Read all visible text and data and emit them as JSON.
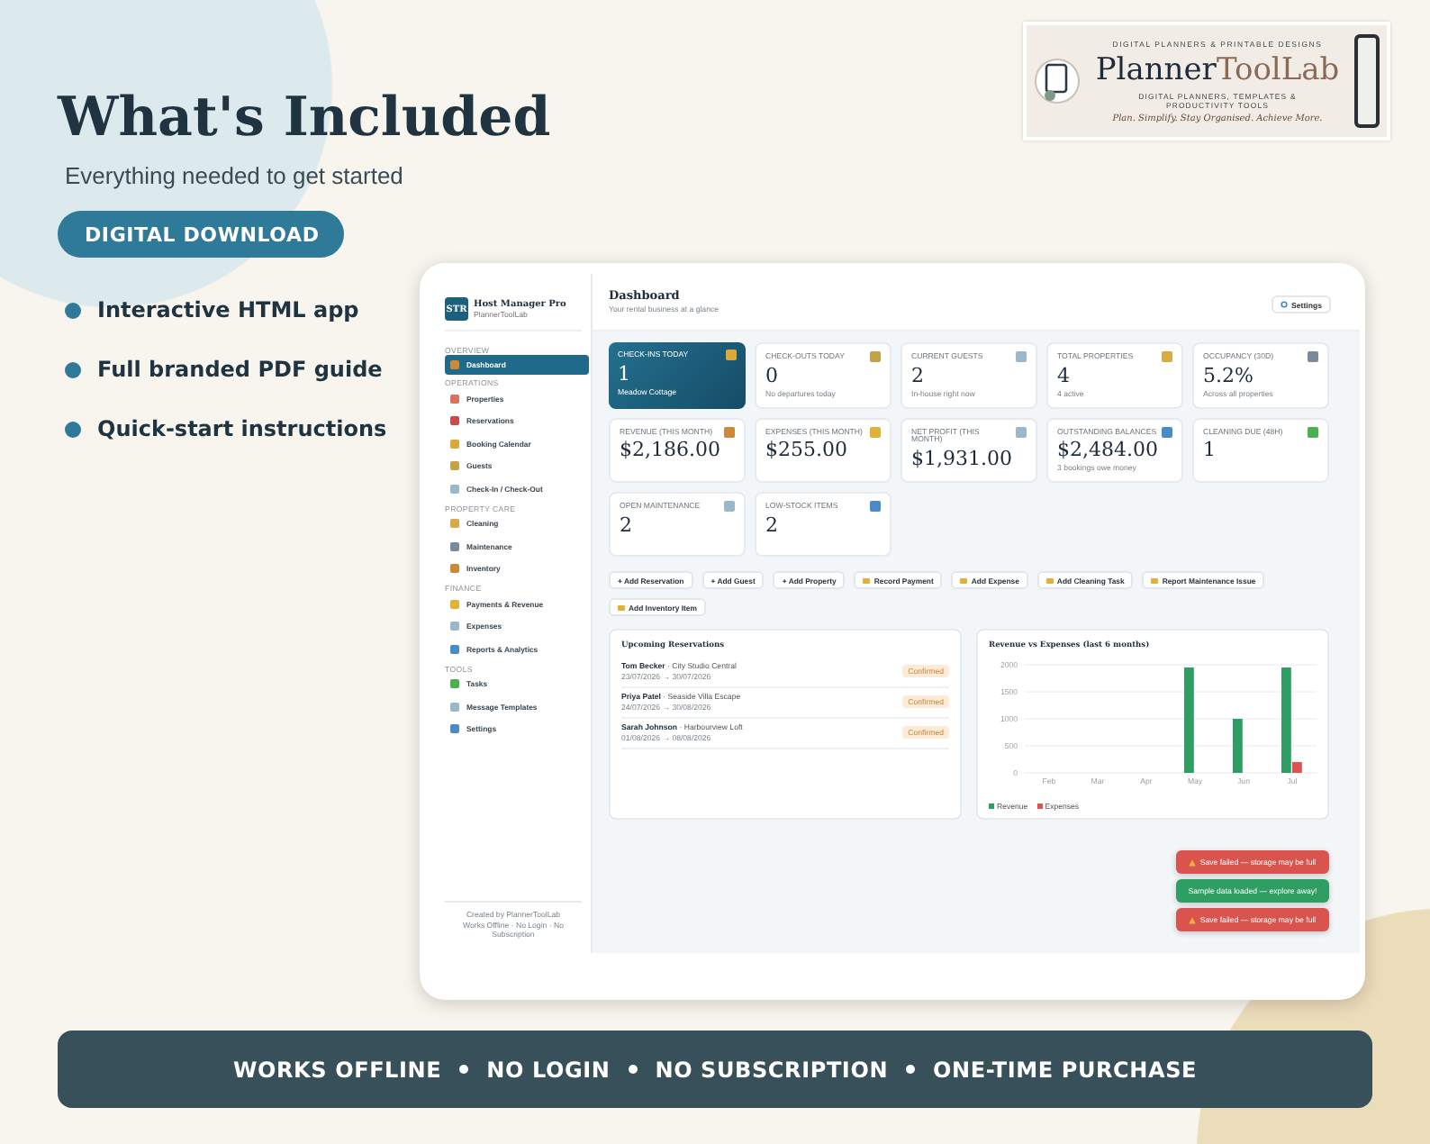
{
  "hero": {
    "title": "What's Included",
    "subtitle": "Everything needed to get started",
    "button": "DIGITAL DOWNLOAD",
    "features": [
      "Interactive HTML app",
      "Full branded PDF guide",
      "Quick-start instructions"
    ]
  },
  "logo_banner": {
    "eyebrow": "DIGITAL PLANNERS & PRINTABLE DESIGNS",
    "brand_first": "Planner",
    "brand_second": "ToolLab",
    "tagline": "DIGITAL PLANNERS, TEMPLATES & PRODUCTIVITY TOOLS",
    "motto": "Plan. Simplify. Stay Organised. Achieve More."
  },
  "app": {
    "brand": {
      "mark": "STR",
      "name": "Host Manager Pro",
      "by": "PlannerToolLab"
    },
    "sidebar": {
      "sections": [
        {
          "heading": "OVERVIEW",
          "items": [
            {
              "label": "Dashboard",
              "selected": true
            }
          ]
        },
        {
          "heading": "OPERATIONS",
          "items": [
            {
              "label": "Properties",
              "selected": false
            },
            {
              "label": "Reservations",
              "selected": false
            },
            {
              "label": "Booking Calendar",
              "selected": false
            },
            {
              "label": "Guests",
              "selected": false
            },
            {
              "label": "Check-In / Check-Out",
              "selected": false
            }
          ]
        },
        {
          "heading": "PROPERTY CARE",
          "items": [
            {
              "label": "Cleaning",
              "selected": false
            },
            {
              "label": "Maintenance",
              "selected": false
            },
            {
              "label": "Inventory",
              "selected": false
            }
          ]
        },
        {
          "heading": "FINANCE",
          "items": [
            {
              "label": "Payments & Revenue",
              "selected": false
            },
            {
              "label": "Expenses",
              "selected": false
            },
            {
              "label": "Reports & Analytics",
              "selected": false
            }
          ]
        },
        {
          "heading": "TOOLS",
          "items": [
            {
              "label": "Tasks",
              "selected": false
            },
            {
              "label": "Message Templates",
              "selected": false
            },
            {
              "label": "Settings",
              "selected": false
            }
          ]
        }
      ],
      "footer": [
        "Created by PlannerToolLab",
        "Works Offline · No Login · No Subscription"
      ]
    },
    "header": {
      "title": "Dashboard",
      "subtitle": "Your rental business at a glance",
      "settings_button": "Settings"
    },
    "stat_cards": [
      {
        "label": "CHECK-INS TODAY",
        "value": "1",
        "note": "Meadow Cottage",
        "highlighted": true
      },
      {
        "label": "CHECK-OUTS TODAY",
        "value": "0",
        "note": "No departures today",
        "highlighted": false
      },
      {
        "label": "CURRENT GUESTS",
        "value": "2",
        "note": "In-house right now",
        "highlighted": false
      },
      {
        "label": "TOTAL PROPERTIES",
        "value": "4",
        "note": "4 active",
        "highlighted": false
      },
      {
        "label": "OCCUPANCY (30D)",
        "value": "5.2%",
        "note": "Across all properties",
        "highlighted": false
      },
      {
        "label": "REVENUE (THIS MONTH)",
        "value": "$2,186.00",
        "highlighted": false
      },
      {
        "label": "EXPENSES (THIS MONTH)",
        "value": "$255.00",
        "highlighted": false
      },
      {
        "label": "NET PROFIT (THIS MONTH)",
        "value": "$1,931.00",
        "highlighted": false
      },
      {
        "label": "OUTSTANDING BALANCES",
        "value": "$2,484.00",
        "note": "3 bookings owe money",
        "highlighted": false
      },
      {
        "label": "CLEANING DUE (48H)",
        "value": "1",
        "highlighted": false
      },
      {
        "label": "OPEN MAINTENANCE",
        "value": "2",
        "highlighted": false
      },
      {
        "label": "LOW-STOCK ITEMS",
        "value": "2",
        "highlighted": false
      }
    ],
    "quick_actions": [
      {
        "label": "+ Add Reservation",
        "kind": "text"
      },
      {
        "label": "+ Add Guest",
        "kind": "text"
      },
      {
        "label": "+ Add Property",
        "kind": "text"
      },
      {
        "label": "Record Payment",
        "kind": "icon"
      },
      {
        "label": "Add Expense",
        "kind": "icon"
      },
      {
        "label": "Add Cleaning Task",
        "kind": "icon"
      },
      {
        "label": "Report Maintenance Issue",
        "kind": "icon"
      },
      {
        "label": "Add Inventory Item",
        "kind": "icon"
      }
    ],
    "reservations": {
      "title": "Upcoming Reservations",
      "rows": [
        {
          "guest": "Tom Becker",
          "property": "· City Studio Central",
          "dates": "23/07/2026 → 30/07/2026",
          "status": "Confirmed"
        },
        {
          "guest": "Priya Patel",
          "property": "· Seaside Villa Escape",
          "dates": "24/07/2026 → 30/08/2026",
          "status": "Confirmed"
        },
        {
          "guest": "Sarah Johnson",
          "property": "· Harbourview Loft",
          "dates": "01/08/2026 → 08/08/2026",
          "status": "Confirmed"
        }
      ]
    },
    "revenue_chart": {
      "chart_data": {
        "type": "bar",
        "title": "Revenue vs Expenses (last 6 months)",
        "categories": [
          "Feb",
          "Mar",
          "Apr",
          "May",
          "Jun",
          "Jul"
        ],
        "series": [
          {
            "name": "Revenue",
            "color": "#2e9e63",
            "values": [
              0,
              0,
              0,
              1950,
              1000,
              1950
            ]
          },
          {
            "name": "Expenses",
            "color": "#e05252",
            "values": [
              0,
              0,
              0,
              0,
              0,
              200
            ]
          }
        ],
        "ylim": [
          0,
          2000
        ],
        "yticks": [
          0,
          500,
          1000,
          1500,
          2000
        ],
        "grid": true,
        "legend": true
      }
    },
    "toasts": [
      {
        "kind": "error",
        "text": "Save failed — storage may be full"
      },
      {
        "kind": "success",
        "text": "Sample data loaded — explore away!"
      },
      {
        "kind": "error",
        "text": "Save failed — storage may be full"
      }
    ]
  },
  "footer_banner": {
    "items": [
      "WORKS OFFLINE",
      "NO LOGIN",
      "NO SUBSCRIPTION",
      "ONE-TIME PURCHASE"
    ]
  }
}
